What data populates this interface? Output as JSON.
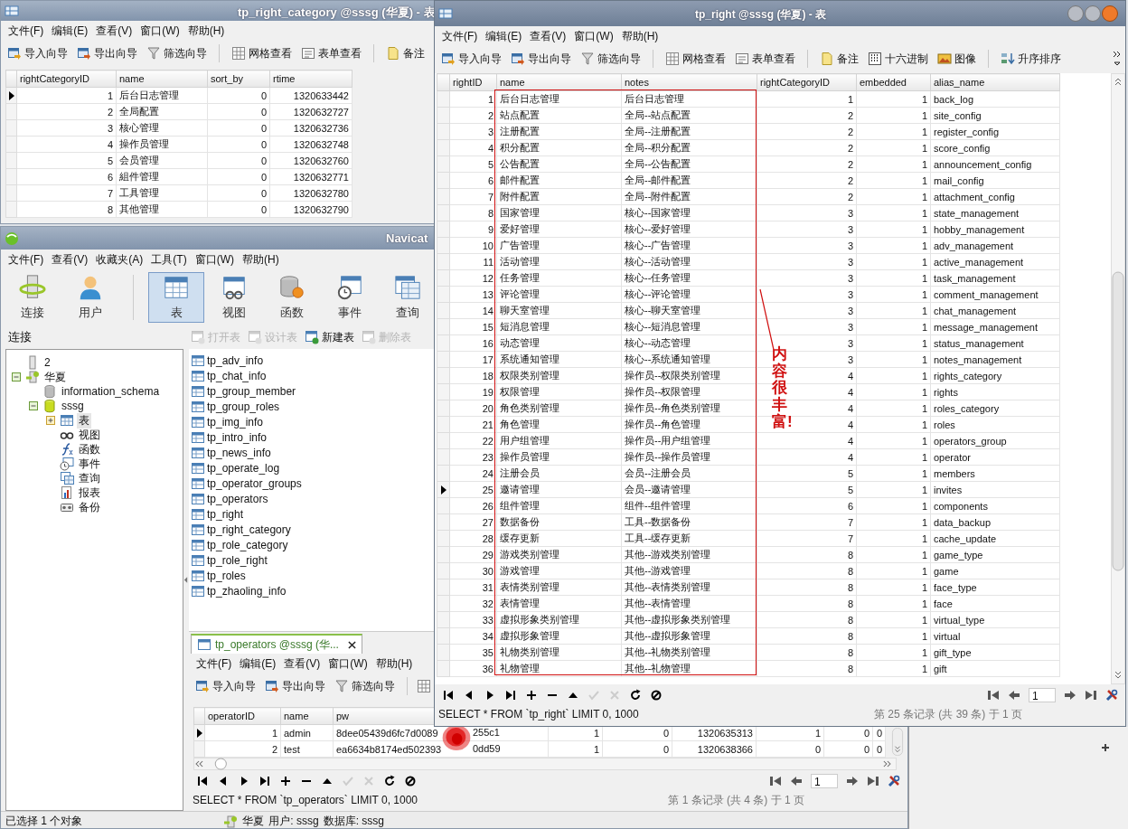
{
  "category_window": {
    "title": "tp_right_category @sssg (华夏) - 表",
    "menu": [
      "文件(F)",
      "编辑(E)",
      "查看(V)",
      "窗口(W)",
      "帮助(H)"
    ],
    "toolbar": [
      "导入向导",
      "导出向导",
      "筛选向导",
      "网格查看",
      "表单查看",
      "备注"
    ],
    "columns": [
      "rightCategoryID",
      "name",
      "sort_by",
      "rtime"
    ],
    "rows": [
      {
        "current": true,
        "rightCategoryID": "1",
        "name": "后台日志管理",
        "sort_by": "0",
        "rtime": "1320633442"
      },
      {
        "current": false,
        "rightCategoryID": "2",
        "name": "全局配置",
        "sort_by": "0",
        "rtime": "1320632727"
      },
      {
        "current": false,
        "rightCategoryID": "3",
        "name": "核心管理",
        "sort_by": "0",
        "rtime": "1320632736"
      },
      {
        "current": false,
        "rightCategoryID": "4",
        "name": "操作员管理",
        "sort_by": "0",
        "rtime": "1320632748"
      },
      {
        "current": false,
        "rightCategoryID": "5",
        "name": "会员管理",
        "sort_by": "0",
        "rtime": "1320632760"
      },
      {
        "current": false,
        "rightCategoryID": "6",
        "name": "組件管理",
        "sort_by": "0",
        "rtime": "1320632771"
      },
      {
        "current": false,
        "rightCategoryID": "7",
        "name": "工具管理",
        "sort_by": "0",
        "rtime": "1320632780"
      },
      {
        "current": false,
        "rightCategoryID": "8",
        "name": "其他管理",
        "sort_by": "0",
        "rtime": "1320632790"
      }
    ]
  },
  "navicat": {
    "title": "Navicat",
    "menu": [
      "文件(F)",
      "查看(V)",
      "收藏夹(A)",
      "工具(T)",
      "窗口(W)",
      "帮助(H)"
    ],
    "big_toolbar": [
      {
        "label": "连接",
        "selected": false
      },
      {
        "label": "用户",
        "selected": false
      },
      {
        "label": "表",
        "selected": true
      },
      {
        "label": "视图",
        "selected": false
      },
      {
        "label": "函数",
        "selected": false
      },
      {
        "label": "事件",
        "selected": false
      },
      {
        "label": "查询",
        "selected": false
      }
    ],
    "connections_label": "连接",
    "object_toolbar": [
      {
        "label": "打开表",
        "disabled": true
      },
      {
        "label": "设计表",
        "disabled": true
      },
      {
        "label": "新建表",
        "disabled": false
      },
      {
        "label": "删除表",
        "disabled": true
      }
    ],
    "tree": [
      {
        "label": "2",
        "kind": "server",
        "selected": false
      },
      {
        "label": "华夏",
        "kind": "connection",
        "selected": false,
        "expanded": true,
        "children": [
          {
            "label": "information_schema",
            "kind": "database",
            "selected": false
          },
          {
            "label": "sssg",
            "kind": "open_database",
            "selected": false,
            "expanded": true,
            "children": [
              {
                "label": "表",
                "kind": "tables",
                "selected": true,
                "expanded": false
              },
              {
                "label": "视图",
                "kind": "views",
                "selected": false
              },
              {
                "label": "函数",
                "kind": "functions",
                "selected": false
              },
              {
                "label": "事件",
                "kind": "events",
                "selected": false
              },
              {
                "label": "查询",
                "kind": "queries",
                "selected": false
              },
              {
                "label": "报表",
                "kind": "reports",
                "selected": false
              },
              {
                "label": "备份",
                "kind": "backups",
                "selected": false
              }
            ]
          }
        ]
      }
    ],
    "tables": [
      "tp_adv_info",
      "tp_chat_info",
      "tp_group_member",
      "tp_group_roles",
      "tp_img_info",
      "tp_intro_info",
      "tp_news_info",
      "tp_operate_log",
      "tp_operator_groups",
      "tp_operators",
      "tp_right",
      "tp_right_category",
      "tp_role_category",
      "tp_role_right",
      "tp_roles",
      "tp_zhaoling_info"
    ],
    "status_left": "已选择 1 个对象",
    "status_connection": "华夏",
    "status_user": "用户: sssg",
    "status_database": "数据库: sssg"
  },
  "operators_tab": {
    "title": "tp_operators @sssg (华...",
    "menu": [
      "文件(F)",
      "编辑(E)",
      "查看(V)",
      "窗口(W)",
      "帮助(H)"
    ],
    "toolbar": [
      "导入向导",
      "导出向导",
      "筛选向导"
    ],
    "columns": [
      "operatorID",
      "name",
      "pw"
    ],
    "rows": [
      {
        "current": true,
        "operatorID": "1",
        "name": "admin",
        "pw_start": "8dee05439d6fc7d0089",
        "pw_end": "255c1",
        "column_4": "1",
        "column_5": "0",
        "column_6": "1320635313",
        "column_7": "1",
        "column_8": "0",
        "column_9": "0"
      },
      {
        "current": false,
        "operatorID": "2",
        "name": "test",
        "pw_start": "ea6634b8174ed502393",
        "pw_end": "0dd59",
        "column_4": "1",
        "column_5": "0",
        "column_6": "1320638366",
        "column_7": "0",
        "column_8": "0",
        "column_9": "0"
      }
    ],
    "sql": "SELECT * FROM `tp_operators` LIMIT 0, 1000",
    "record_info": "第 1 条记录 (共 4 条) 于 1 页",
    "page": "1"
  },
  "right_window": {
    "title": "tp_right @sssg (华夏) - 表",
    "menu": [
      "文件(F)",
      "编辑(E)",
      "查看(V)",
      "窗口(W)",
      "帮助(H)"
    ],
    "toolbar": [
      "导入向导",
      "导出向导",
      "筛选向导",
      "网格查看",
      "表单查看",
      "备注",
      "十六进制",
      "图像",
      "升序排序"
    ],
    "columns": [
      "rightID",
      "name",
      "notes",
      "rightCategoryID",
      "embedded",
      "alias_name"
    ],
    "rows": [
      {
        "current": false,
        "rightID": "1",
        "name": "后台日志管理",
        "notes": "后台日志管理",
        "rightCategoryID": "1",
        "embedded": "1",
        "alias_name": "back_log"
      },
      {
        "current": false,
        "rightID": "2",
        "name": "站点配置",
        "notes": "全局--站点配置",
        "rightCategoryID": "2",
        "embedded": "1",
        "alias_name": "site_config"
      },
      {
        "current": false,
        "rightID": "3",
        "name": "注册配置",
        "notes": "全局--注册配置",
        "rightCategoryID": "2",
        "embedded": "1",
        "alias_name": "register_config"
      },
      {
        "current": false,
        "rightID": "4",
        "name": "积分配置",
        "notes": "全局--积分配置",
        "rightCategoryID": "2",
        "embedded": "1",
        "alias_name": "score_config"
      },
      {
        "current": false,
        "rightID": "5",
        "name": "公告配置",
        "notes": "全局--公告配置",
        "rightCategoryID": "2",
        "embedded": "1",
        "alias_name": "announcement_config"
      },
      {
        "current": false,
        "rightID": "6",
        "name": "邮件配置",
        "notes": "全局--邮件配置",
        "rightCategoryID": "2",
        "embedded": "1",
        "alias_name": "mail_config"
      },
      {
        "current": false,
        "rightID": "7",
        "name": "附件配置",
        "notes": "全局--附件配置",
        "rightCategoryID": "2",
        "embedded": "1",
        "alias_name": "attachment_config"
      },
      {
        "current": false,
        "rightID": "8",
        "name": "国家管理",
        "notes": "核心--国家管理",
        "rightCategoryID": "3",
        "embedded": "1",
        "alias_name": "state_management"
      },
      {
        "current": false,
        "rightID": "9",
        "name": "爱好管理",
        "notes": "核心--爱好管理",
        "rightCategoryID": "3",
        "embedded": "1",
        "alias_name": "hobby_management"
      },
      {
        "current": false,
        "rightID": "10",
        "name": "广告管理",
        "notes": "核心--广告管理",
        "rightCategoryID": "3",
        "embedded": "1",
        "alias_name": "adv_management"
      },
      {
        "current": false,
        "rightID": "11",
        "name": "活动管理",
        "notes": "核心--活动管理",
        "rightCategoryID": "3",
        "embedded": "1",
        "alias_name": "active_management"
      },
      {
        "current": false,
        "rightID": "12",
        "name": "任务管理",
        "notes": "核心--任务管理",
        "rightCategoryID": "3",
        "embedded": "1",
        "alias_name": "task_management"
      },
      {
        "current": false,
        "rightID": "13",
        "name": "评论管理",
        "notes": "核心--评论管理",
        "rightCategoryID": "3",
        "embedded": "1",
        "alias_name": "comment_management"
      },
      {
        "current": false,
        "rightID": "14",
        "name": "聊天室管理",
        "notes": "核心--聊天室管理",
        "rightCategoryID": "3",
        "embedded": "1",
        "alias_name": "chat_management"
      },
      {
        "current": false,
        "rightID": "15",
        "name": "短消息管理",
        "notes": "核心--短消息管理",
        "rightCategoryID": "3",
        "embedded": "1",
        "alias_name": "message_management"
      },
      {
        "current": false,
        "rightID": "16",
        "name": "动态管理",
        "notes": "核心--动态管理",
        "rightCategoryID": "3",
        "embedded": "1",
        "alias_name": "status_management"
      },
      {
        "current": false,
        "rightID": "17",
        "name": "系统通知管理",
        "notes": "核心--系统通知管理",
        "rightCategoryID": "3",
        "embedded": "1",
        "alias_name": "notes_management"
      },
      {
        "current": false,
        "rightID": "18",
        "name": "权限类别管理",
        "notes": "操作员--权限类别管理",
        "rightCategoryID": "4",
        "embedded": "1",
        "alias_name": "rights_category"
      },
      {
        "current": false,
        "rightID": "19",
        "name": "权限管理",
        "notes": "操作员--权限管理",
        "rightCategoryID": "4",
        "embedded": "1",
        "alias_name": "rights"
      },
      {
        "current": false,
        "rightID": "20",
        "name": "角色类别管理",
        "notes": "操作员--角色类别管理",
        "rightCategoryID": "4",
        "embedded": "1",
        "alias_name": "roles_category"
      },
      {
        "current": false,
        "rightID": "21",
        "name": "角色管理",
        "notes": "操作员--角色管理",
        "rightCategoryID": "4",
        "embedded": "1",
        "alias_name": "roles"
      },
      {
        "current": false,
        "rightID": "22",
        "name": "用户组管理",
        "notes": "操作员--用户组管理",
        "rightCategoryID": "4",
        "embedded": "1",
        "alias_name": "operators_group"
      },
      {
        "current": false,
        "rightID": "23",
        "name": "操作员管理",
        "notes": "操作员--操作员管理",
        "rightCategoryID": "4",
        "embedded": "1",
        "alias_name": "operator"
      },
      {
        "current": false,
        "rightID": "24",
        "name": "注册会员",
        "notes": "会员--注册会员",
        "rightCategoryID": "5",
        "embedded": "1",
        "alias_name": "members"
      },
      {
        "current": true,
        "rightID": "25",
        "name": "邀请管理",
        "notes": "会员--邀请管理",
        "rightCategoryID": "5",
        "embedded": "1",
        "alias_name": "invites"
      },
      {
        "current": false,
        "rightID": "26",
        "name": "组件管理",
        "notes": "组件--组件管理",
        "rightCategoryID": "6",
        "embedded": "1",
        "alias_name": "components"
      },
      {
        "current": false,
        "rightID": "27",
        "name": "数据备份",
        "notes": "工具--数据备份",
        "rightCategoryID": "7",
        "embedded": "1",
        "alias_name": "data_backup"
      },
      {
        "current": false,
        "rightID": "28",
        "name": "缓存更新",
        "notes": "工具--缓存更新",
        "rightCategoryID": "7",
        "embedded": "1",
        "alias_name": "cache_update"
      },
      {
        "current": false,
        "rightID": "29",
        "name": "游戏类别管理",
        "notes": "其他--游戏类别管理",
        "rightCategoryID": "8",
        "embedded": "1",
        "alias_name": "game_type"
      },
      {
        "current": false,
        "rightID": "30",
        "name": "游戏管理",
        "notes": "其他--游戏管理",
        "rightCategoryID": "8",
        "embedded": "1",
        "alias_name": "game"
      },
      {
        "current": false,
        "rightID": "31",
        "name": "表情类别管理",
        "notes": "其他--表情类别管理",
        "rightCategoryID": "8",
        "embedded": "1",
        "alias_name": "face_type"
      },
      {
        "current": false,
        "rightID": "32",
        "name": "表情管理",
        "notes": "其他--表情管理",
        "rightCategoryID": "8",
        "embedded": "1",
        "alias_name": "face"
      },
      {
        "current": false,
        "rightID": "33",
        "name": "虚拟形象类别管理",
        "notes": "其他--虚拟形象类别管理",
        "rightCategoryID": "8",
        "embedded": "1",
        "alias_name": "virtual_type"
      },
      {
        "current": false,
        "rightID": "34",
        "name": "虚拟形象管理",
        "notes": "其他--虚拟形象管理",
        "rightCategoryID": "8",
        "embedded": "1",
        "alias_name": "virtual"
      },
      {
        "current": false,
        "rightID": "35",
        "name": "礼物类别管理",
        "notes": "其他--礼物类别管理",
        "rightCategoryID": "8",
        "embedded": "1",
        "alias_name": "gift_type"
      },
      {
        "current": false,
        "rightID": "36",
        "name": "礼物管理",
        "notes": "其他--礼物管理",
        "rightCategoryID": "8",
        "embedded": "1",
        "alias_name": "gift"
      }
    ],
    "annotation": "内容很丰富!",
    "sql": "SELECT * FROM `tp_right` LIMIT 0, 1000",
    "record_info": "第 25 条记录 (共 39 条) 于 1 页",
    "page": "1"
  }
}
